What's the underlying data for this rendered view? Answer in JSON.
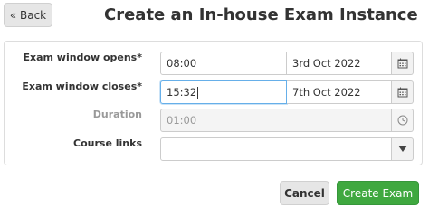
{
  "header": {
    "back_label": "« Back",
    "title": "Create an In-house Exam Instance"
  },
  "form": {
    "opens": {
      "label": "Exam window opens*",
      "time": "08:00",
      "date": "3rd Oct 2022",
      "icon": "calendar-icon"
    },
    "closes": {
      "label": "Exam window closes*",
      "time": "15:32",
      "date": "7th Oct 2022",
      "icon": "calendar-icon"
    },
    "duration": {
      "label": "Duration",
      "value": "01:00",
      "icon": "clock-icon"
    },
    "course_links": {
      "label": "Course links",
      "value": "",
      "icon": "caret-down-icon"
    }
  },
  "actions": {
    "cancel_label": "Cancel",
    "create_label": "Create Exam"
  },
  "colors": {
    "primary": "#3fa83f",
    "focus": "#66afe9",
    "muted": "#999999"
  }
}
